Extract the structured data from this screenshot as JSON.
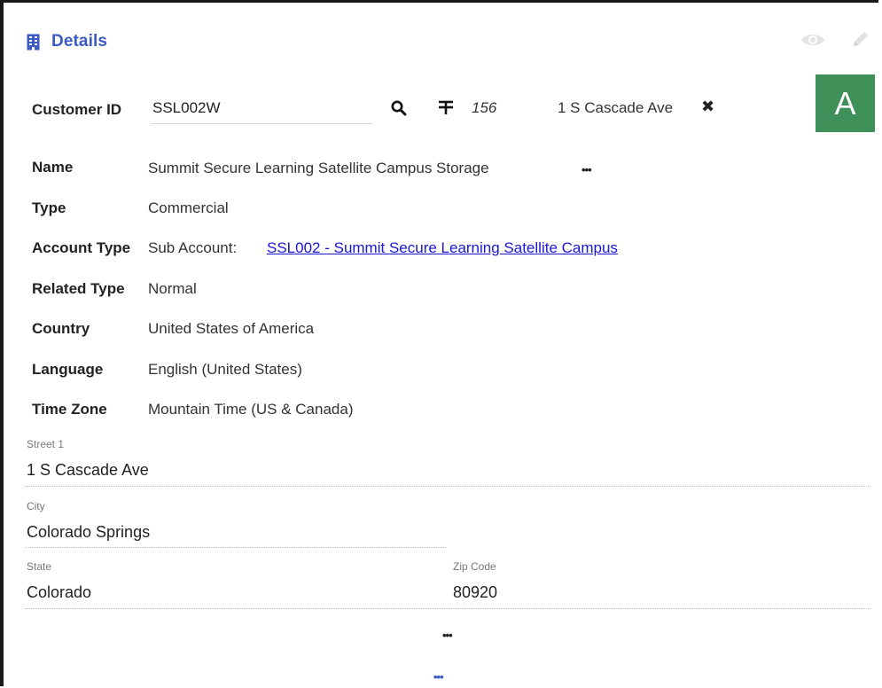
{
  "header": {
    "title": "Details",
    "icon": "building-icon"
  },
  "toolbar": {
    "view_icon": "eye-icon",
    "edit_icon": "pencil-icon"
  },
  "customer": {
    "label": "Customer ID",
    "value": "SSL002W",
    "search_icon": "search-icon",
    "hash_icon": "hash-icon",
    "number": "156",
    "address": "1 S Cascade Ave",
    "clear_icon": "close-icon"
  },
  "avatar": {
    "letter": "A",
    "color": "#3e8f58"
  },
  "fields": {
    "name": {
      "label": "Name",
      "value": "Summit Secure Learning Satellite Campus Storage"
    },
    "type": {
      "label": "Type",
      "value": "Commercial"
    },
    "account_type": {
      "label": "Account Type",
      "prefix": "Sub Account:",
      "link": "SSL002 - Summit Secure Learning Satellite Campus"
    },
    "related_type": {
      "label": "Related Type",
      "value": "Normal"
    },
    "country": {
      "label": "Country",
      "value": "United States of America"
    },
    "language": {
      "label": "Language",
      "value": "English (United States)"
    },
    "time_zone": {
      "label": "Time Zone",
      "value": "Mountain Time (US & Canada)"
    }
  },
  "address": {
    "street1": {
      "label": "Street 1",
      "value": "1 S Cascade Ave"
    },
    "city": {
      "label": "City",
      "value": "Colorado Springs"
    },
    "state": {
      "label": "State",
      "value": "Colorado"
    },
    "zip": {
      "label": "Zip Code",
      "value": "80920"
    }
  },
  "more": {
    "dots": "•••",
    "bottom_dots": "•••"
  }
}
